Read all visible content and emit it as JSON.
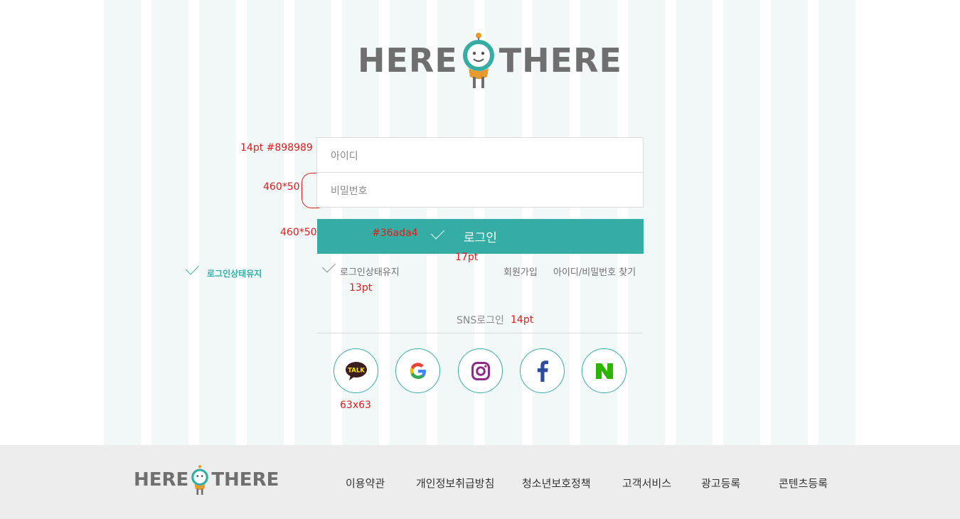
{
  "logo": {
    "word_left": "HERE",
    "word_right": "THERE"
  },
  "annotations": {
    "field_font": "14pt #898989",
    "field_size": "460*50",
    "button_size": "460*50",
    "button_color": "#36ada4",
    "button_font": "17pt",
    "small_font": "13pt",
    "sns_font": "14pt",
    "icon_size": "63x63",
    "keep_login_sample": "로그인상태유지"
  },
  "form": {
    "id_placeholder": "아이디",
    "pw_placeholder": "비밀번호",
    "login_label": "로그인",
    "keep_login": "로그인상태유지",
    "signup": "회원가입",
    "find": "아이디/비밀번호 찾기"
  },
  "sns": {
    "title": "SNS로그인",
    "items": [
      "kakao-talk",
      "google",
      "instagram",
      "facebook",
      "naver"
    ],
    "kakao_label": "TALK"
  },
  "footer": {
    "links": [
      "이용약관",
      "개인정보취급방침",
      "청소년보호정책",
      "고객서비스",
      "광고등록",
      "콘텐츠등록"
    ]
  },
  "colors": {
    "accent": "#36ada4",
    "placeholder": "#898989",
    "annotation": "#e01d1d",
    "footer_bg": "#ededed"
  }
}
